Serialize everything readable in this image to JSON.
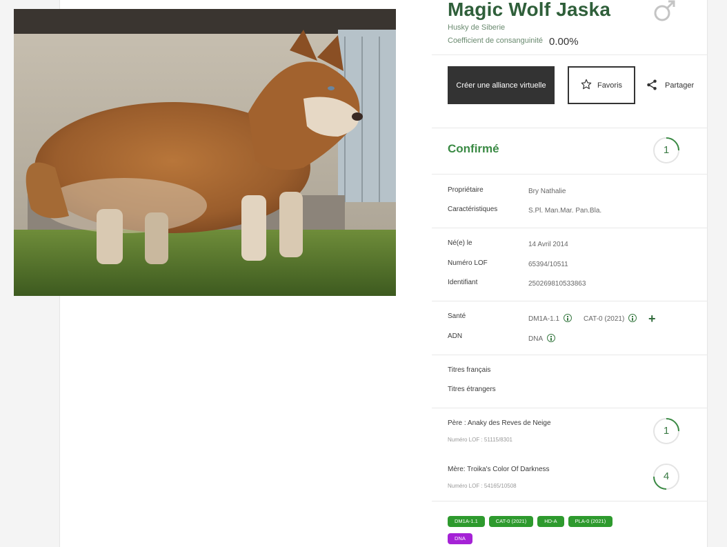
{
  "dog": {
    "name": "Magic Wolf Jaska",
    "breed": "Husky de Siberie",
    "coef_label": "Coefficient de consanguinité",
    "coef_value": "0.00%"
  },
  "actions": {
    "alliance_label": "Créer une alliance virtuelle",
    "favoris_label": "Favoris",
    "share_label": "Partager"
  },
  "status": {
    "label": "Confirmé",
    "count": "1"
  },
  "owner": {
    "label": "Propriétaire",
    "value": "Bry Nathalie"
  },
  "characteristics": {
    "label": "Caractéristiques",
    "value": "S.Pl. Man.Mar. Pan.Bla."
  },
  "details": {
    "born_label": "Né(e) le",
    "born_value": "14 Avril 2014",
    "lof_label": "Numéro LOF",
    "lof_value": "65394/10511",
    "id_label": "Identifiant",
    "id_value": "250269810533863"
  },
  "health": {
    "label": "Santé",
    "tests": [
      "DM1A-1.1",
      "CAT-0 (2021)"
    ],
    "adn_label": "ADN",
    "adn_value": "DNA"
  },
  "titles": {
    "fr_label": "Titres français",
    "foreign_label": "Titres étrangers"
  },
  "parents": {
    "father": {
      "label": "Père : Anaky des Reves de Neige",
      "lof": "Numéro LOF : 51115/8301",
      "count": "1"
    },
    "mother": {
      "label": "Mère: Troika's Color Of Darkness",
      "lof": "Numéro LOF : 54165/10508",
      "count": "4"
    }
  },
  "tags": [
    {
      "label": "DM1A-1.1",
      "color": "#2e9a2e"
    },
    {
      "label": "CAT-0 (2021)",
      "color": "#2e9a2e"
    },
    {
      "label": "HD-A",
      "color": "#2e9a2e"
    },
    {
      "label": "PLA-0 (2021)",
      "color": "#2e9a2e"
    },
    {
      "label": "DNA",
      "color": "#a522d6"
    }
  ],
  "icons": {
    "gender": "male-symbol-icon",
    "favoris": "star-outline-icon",
    "share": "share-icon",
    "info": "info-circle-icon",
    "add": "plus-icon"
  },
  "colors": {
    "accent": "#3a8a44",
    "title": "#2f5f3a"
  }
}
